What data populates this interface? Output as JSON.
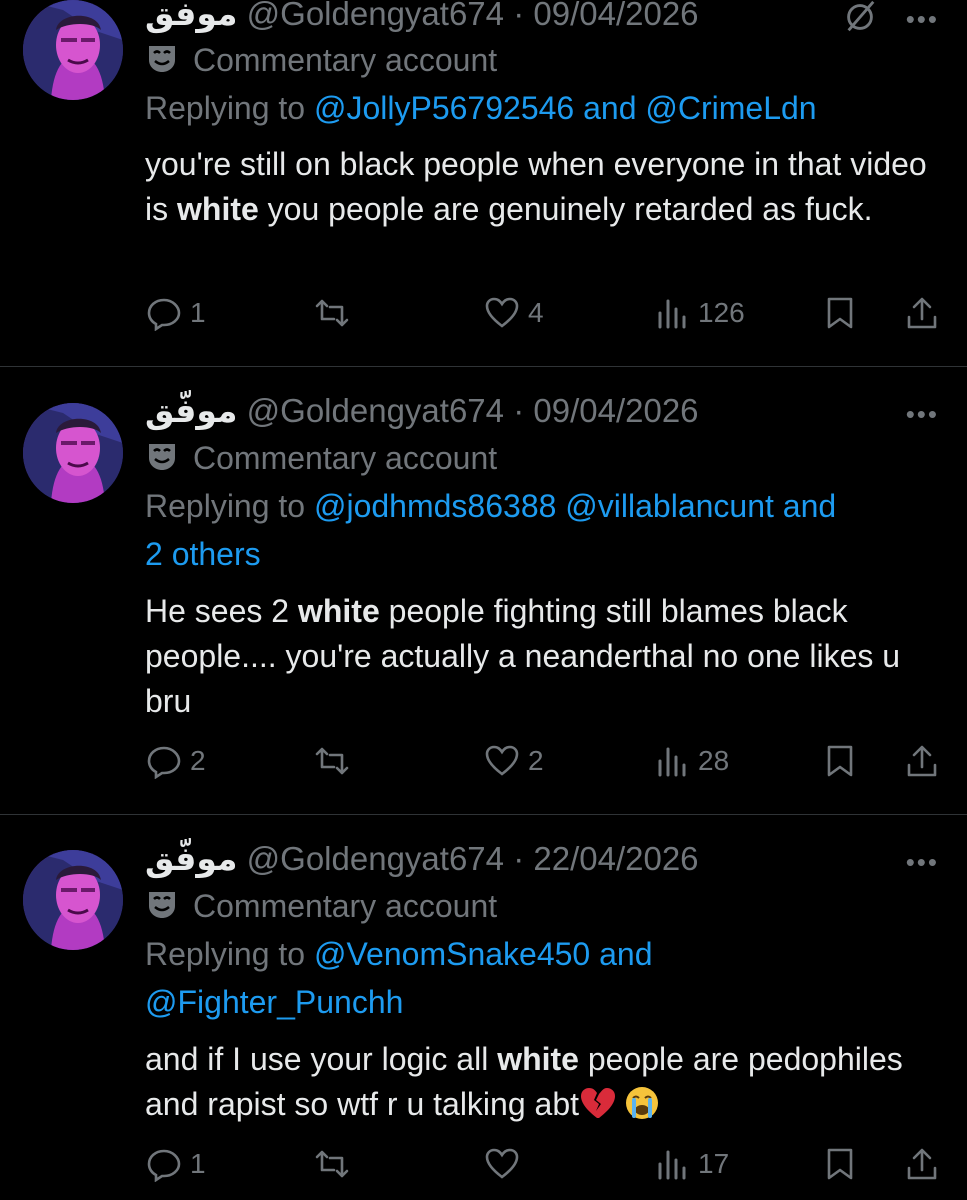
{
  "tweets": [
    {
      "name": "موفق",
      "handle": "@Goldengyat674",
      "dot": "·",
      "date": "09/04/2026",
      "badge": "Commentary account",
      "replying_prefix": "Replying to",
      "mentions_line": "@JollyP56792546 and @CrimeLdn",
      "mentions_line2": "",
      "text_parts": [
        "you're still on black people  when everyone in that video is ",
        "white",
        " you people are genuinely retarded as fuck."
      ],
      "replies": "1",
      "retweets": "",
      "likes": "4",
      "views": "126"
    },
    {
      "name": "موفّق",
      "handle": "@Goldengyat674",
      "dot": "·",
      "date": "09/04/2026",
      "badge": "Commentary account",
      "replying_prefix": "Replying to",
      "mentions_line": "@jodhmds86388 @villablancunt and",
      "mentions_line2": "2 others",
      "text_parts": [
        "He sees 2 ",
        "white",
        " people fighting still blames black people.... you're actually a neanderthal no one likes u bru"
      ],
      "replies": "2",
      "retweets": "",
      "likes": "2",
      "views": "28"
    },
    {
      "name": "موفّق",
      "handle": "@Goldengyat674",
      "dot": "·",
      "date": "22/04/2026",
      "badge": "Commentary account",
      "replying_prefix": "Replying to",
      "mentions_line": "@VenomSnake450 and",
      "mentions_line2": "@Fighter_Punchh",
      "text_parts": [
        "and if I use your logic all ",
        "white",
        " people are pedophiles and rapist so wtf r u talking abt"
      ],
      "replies": "1",
      "retweets": "",
      "likes": "",
      "views": "17"
    }
  ],
  "icons": {
    "more": "more-icon",
    "grok": "grok-icon",
    "badge": "mask-icon",
    "reply": "reply-icon",
    "retweet": "retweet-icon",
    "like": "heart-icon",
    "views": "views-icon",
    "bookmark": "bookmark-icon",
    "share": "share-icon",
    "emoji1": "broken-heart-emoji",
    "emoji2": "crying-face-emoji"
  },
  "colors": {
    "background": "#000000",
    "text": "#e7e9ea",
    "muted": "#71767b",
    "link": "#1d9bf0"
  }
}
